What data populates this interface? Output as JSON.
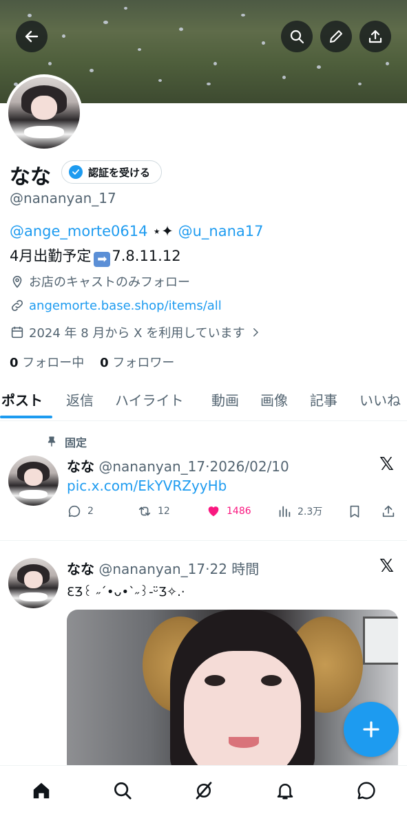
{
  "header": {
    "back_icon": "arrow-left-icon",
    "search_icon": "search-icon",
    "edit_icon": "pencil-icon",
    "share_icon": "upload-icon"
  },
  "profile": {
    "display_name": "なな",
    "verify_label": "認証を受ける",
    "handle": "@nananyan_17",
    "bio_link1": "@ange_morte0614",
    "bio_sparkle": "⋆✦",
    "bio_link2": "@u_nana17",
    "bio_line2_prefix": "4月出勤予定",
    "bio_line2_suffix": "7.8.11.12",
    "location": "お店のキャストのみフォロー",
    "website": "angemorte.base.shop/items/all",
    "joined": "2024 年 8 月から X を利用しています",
    "following_count": "0",
    "following_label": "フォロー中",
    "followers_count": "0",
    "followers_label": "フォロワー"
  },
  "tabs": [
    "ポスト",
    "返信",
    "ハイライト",
    "動画",
    "画像",
    "記事",
    "いいね"
  ],
  "posts": [
    {
      "pinned_label": "固定",
      "author": "なな",
      "handle": "@nananyan_17",
      "sep": "·",
      "time": "2026/02/10",
      "text": "pic.x.com/EkYVRZyyHb",
      "replies": "2",
      "reposts": "12",
      "likes": "1486",
      "views": "2.3万"
    },
    {
      "author": "なな",
      "handle": "@nananyan_17",
      "sep": "·",
      "time": "22 時間",
      "text": "ƐٛƷ꒰ ˶´•ᴗ•`˶꒱-ᵕ̈Ʒ✧.·"
    }
  ],
  "colors": {
    "accent": "#1d9bf0",
    "like": "#f91880",
    "muted": "#536471"
  }
}
